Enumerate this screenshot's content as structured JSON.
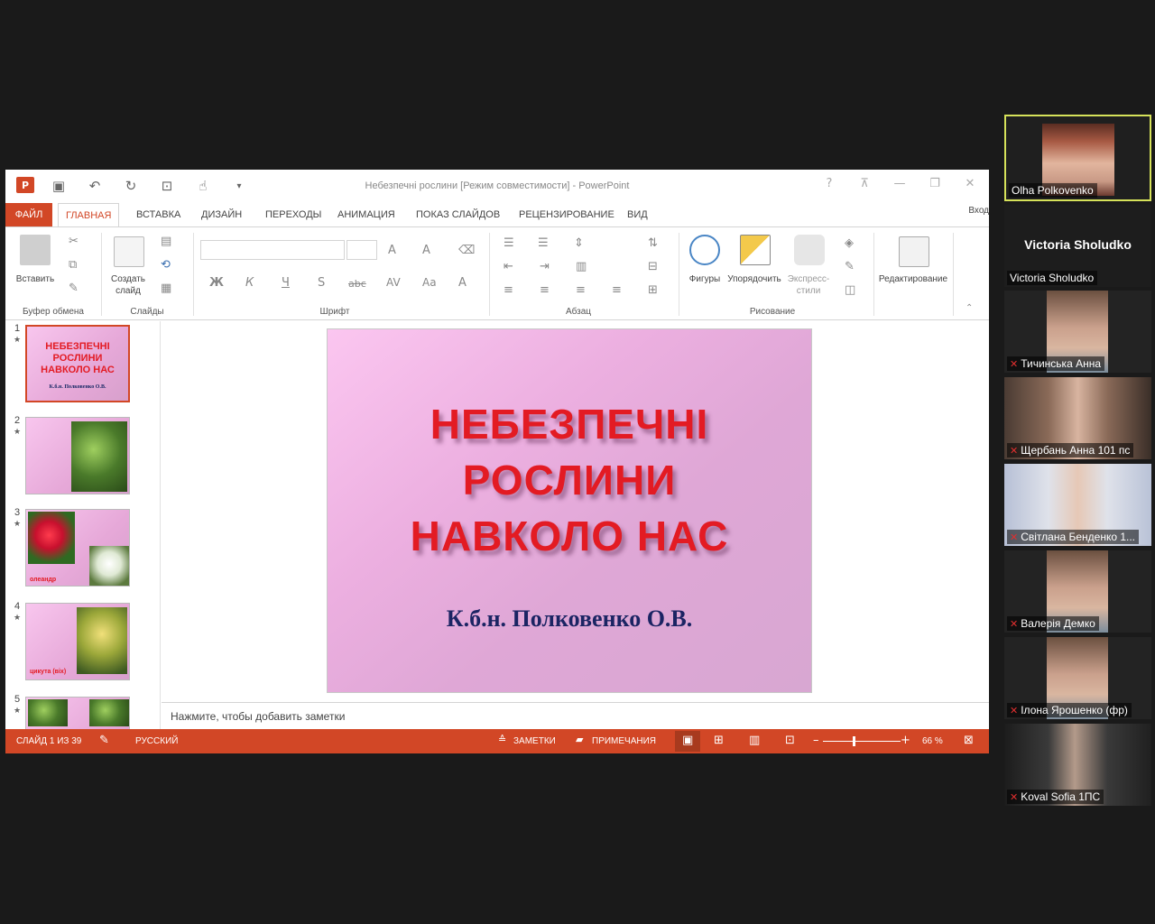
{
  "window": {
    "title": "Небезпечні рослини [Режим совместимости] - PowerPoint",
    "help": "?",
    "signin": "Вход",
    "app_icon": "P"
  },
  "tabs": [
    "ФАЙЛ",
    "ГЛАВНАЯ",
    "ВСТАВКА",
    "ДИЗАЙН",
    "ПЕРЕХОДЫ",
    "АНИМАЦИЯ",
    "ПОКАЗ СЛАЙДОВ",
    "РЕЦЕНЗИРОВАНИЕ",
    "ВИД"
  ],
  "ribbon": {
    "paste_label": "Вставить",
    "new_slide_line1": "Создать",
    "new_slide_line2": "слайд",
    "groups": {
      "clipboard": "Буфер обмена",
      "slides": "Слайды",
      "font": "Шрифт",
      "paragraph": "Абзац",
      "drawing": "Рисование"
    },
    "font_buttons": [
      "Ж",
      "К",
      "Ч",
      "S",
      "abc",
      "AV",
      "Aa",
      "A"
    ],
    "shapes": "Фигуры",
    "arrange": "Упорядочить",
    "quick_styles_1": "Экспресс-",
    "quick_styles_2": "стили",
    "editing": "Редактирование"
  },
  "thumbnails": [
    {
      "num": "1",
      "title": "НЕБЕЗПЕЧНІ РОСЛИНИ НАВКОЛО НАС",
      "sub": "К.б.н. Полковенко О.В."
    },
    {
      "num": "2"
    },
    {
      "num": "3",
      "caption": "олеандр"
    },
    {
      "num": "4",
      "caption": "цикута (віх)"
    },
    {
      "num": "5"
    }
  ],
  "slide": {
    "title_line1": "НЕБЕЗПЕЧНІ",
    "title_line2": "РОСЛИНИ",
    "title_line3": "НАВКОЛО НАС",
    "subtitle": "К.б.н. Полковенко О.В."
  },
  "notes_placeholder": "Нажмите, чтобы добавить заметки",
  "status": {
    "slide_counter": "СЛАЙД 1 ИЗ 39",
    "language": "РУССКИЙ",
    "notes": "ЗАМЕТКИ",
    "comments": "ПРИМЕЧАНИЯ",
    "zoom": "66 %",
    "zoom_fraction": 0.4
  },
  "participants": [
    {
      "name": "Olha Polkovenko",
      "muted": false
    },
    {
      "name": "Victoria Sholudko",
      "big_name": "Victoria Sholudko",
      "muted": false
    },
    {
      "name": "Тичинська Анна",
      "muted": true
    },
    {
      "name": "Щербань Анна 101 пс",
      "muted": true
    },
    {
      "name": "Світлана Бенденко 1...",
      "muted": true
    },
    {
      "name": "Валерія Демко",
      "muted": true
    },
    {
      "name": "Ілона Ярошенко (фр)",
      "muted": true
    },
    {
      "name": "Koval Sofia 1ПС",
      "muted": true
    }
  ],
  "colors": {
    "accent": "#d24726",
    "slide_title": "#e31b23",
    "slide_subtitle": "#1b2463",
    "active_speaker_border": "#d6e25a"
  }
}
